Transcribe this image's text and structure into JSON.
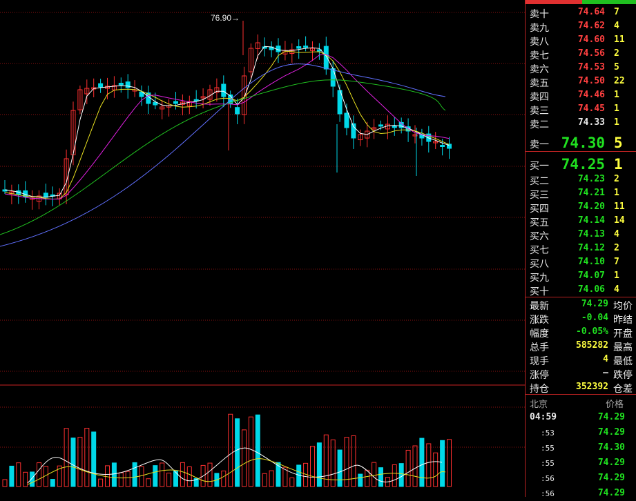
{
  "colors": {
    "up": "#ff3030",
    "down": "#00d8e8",
    "ma5": "#ffffff",
    "ma10": "#e8e020",
    "ma20": "#e020e0",
    "ma40": "#20c020",
    "ma60": "#6070ff",
    "grid": "#8a1010"
  },
  "chart": {
    "high_label": "76.90"
  },
  "ask": [
    {
      "label": "卖十",
      "price": "74.64",
      "vol": "7",
      "color": "red"
    },
    {
      "label": "卖九",
      "price": "74.62",
      "vol": "4",
      "color": "red"
    },
    {
      "label": "卖八",
      "price": "74.60",
      "vol": "11",
      "color": "red"
    },
    {
      "label": "卖七",
      "price": "74.56",
      "vol": "2",
      "color": "red"
    },
    {
      "label": "卖六",
      "price": "74.53",
      "vol": "5",
      "color": "red"
    },
    {
      "label": "卖五",
      "price": "74.50",
      "vol": "22",
      "color": "red"
    },
    {
      "label": "卖四",
      "price": "74.46",
      "vol": "1",
      "color": "red"
    },
    {
      "label": "卖三",
      "price": "74.45",
      "vol": "1",
      "color": "red"
    },
    {
      "label": "卖二",
      "price": "74.33",
      "vol": "1",
      "color": "white"
    }
  ],
  "ask1": {
    "label": "卖一",
    "price": "74.30",
    "vol": "5"
  },
  "bid1": {
    "label": "买一",
    "price": "74.25",
    "vol": "1"
  },
  "bid": [
    {
      "label": "买二",
      "price": "74.23",
      "vol": "2"
    },
    {
      "label": "买三",
      "price": "74.21",
      "vol": "1"
    },
    {
      "label": "买四",
      "price": "74.20",
      "vol": "11"
    },
    {
      "label": "买五",
      "price": "74.14",
      "vol": "14"
    },
    {
      "label": "买六",
      "price": "74.13",
      "vol": "4"
    },
    {
      "label": "买七",
      "price": "74.12",
      "vol": "2"
    },
    {
      "label": "买八",
      "price": "74.10",
      "vol": "7"
    },
    {
      "label": "买九",
      "price": "74.07",
      "vol": "1"
    },
    {
      "label": "买十",
      "price": "74.06",
      "vol": "4"
    }
  ],
  "stats": [
    {
      "k": "最新",
      "v": "74.29",
      "k2": "均价",
      "color": "green"
    },
    {
      "k": "涨跌",
      "v": "-0.04",
      "k2": "昨结",
      "color": "green"
    },
    {
      "k": "幅度",
      "v": "-0.05%",
      "k2": "开盘",
      "color": "green"
    },
    {
      "k": "总手",
      "v": "585282",
      "k2": "最高",
      "color": "yellow"
    },
    {
      "k": "现手",
      "v": "4",
      "k2": "最低",
      "color": "yellow"
    },
    {
      "k": "涨停",
      "v": "—",
      "k2": "跌停",
      "color": "white"
    },
    {
      "k": "持仓",
      "v": "352392",
      "k2": "仓差",
      "color": "yellow"
    }
  ],
  "ticks_header": {
    "loc": "北京",
    "price": "价格"
  },
  "ticks": [
    {
      "t": "04:59",
      "p": "74.29"
    },
    {
      "t": ":53",
      "p": "74.29"
    },
    {
      "t": ":55",
      "p": "74.30"
    },
    {
      "t": ":55",
      "p": "74.29"
    },
    {
      "t": ":56",
      "p": "74.29"
    },
    {
      "t": ":56",
      "p": "74.29"
    }
  ]
}
